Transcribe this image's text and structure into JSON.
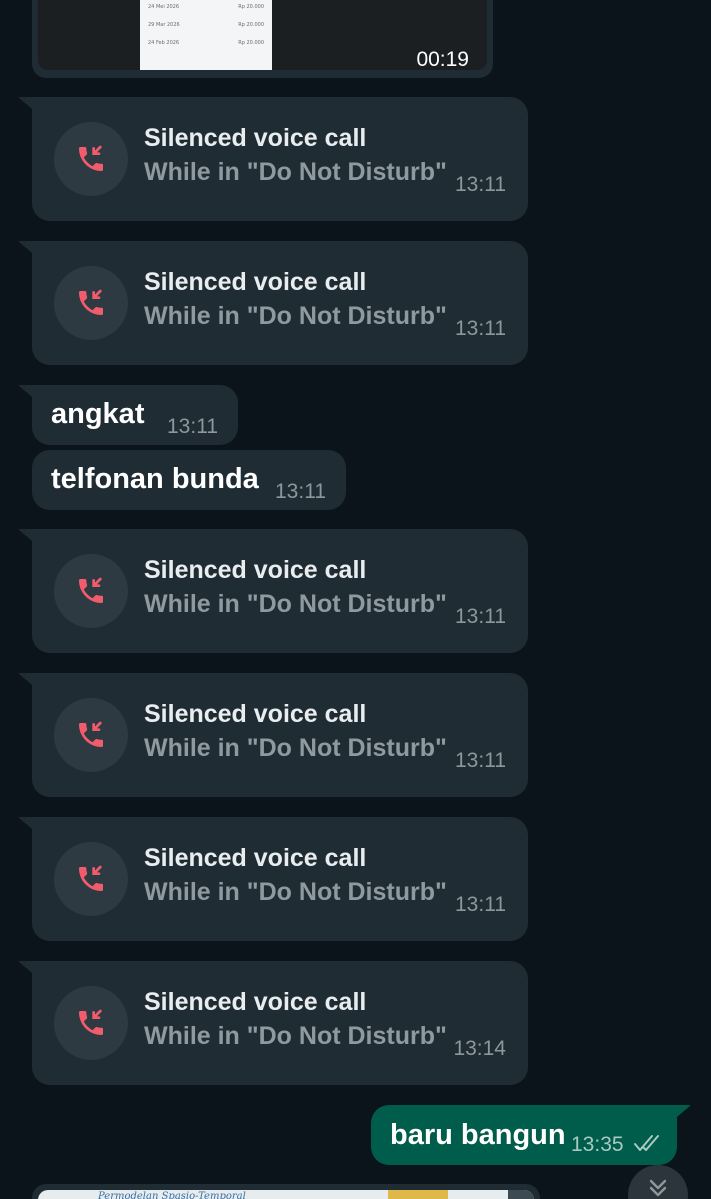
{
  "video_message": {
    "duration": "00:19",
    "receipt_rows": [
      {
        "date": "24 Mei 2026",
        "amount": "Rp 20.000"
      },
      {
        "date": "29 Mar 2026",
        "amount": "Rp 20.000"
      },
      {
        "date": "24 Feb 2026",
        "amount": "Rp 20.000"
      }
    ]
  },
  "messages": [
    {
      "type": "call",
      "title": "Silenced voice call",
      "subtitle": "While in \"Do Not Disturb\"",
      "time": "13:11"
    },
    {
      "type": "call",
      "title": "Silenced voice call",
      "subtitle": "While in \"Do Not Disturb\"",
      "time": "13:11"
    },
    {
      "type": "text",
      "text": "angkat",
      "time": "13:11"
    },
    {
      "type": "text",
      "text": "telfonan bunda",
      "time": "13:11"
    },
    {
      "type": "call",
      "title": "Silenced voice call",
      "subtitle": "While in \"Do Not Disturb\"",
      "time": "13:11"
    },
    {
      "type": "call",
      "title": "Silenced voice call",
      "subtitle": "While in \"Do Not Disturb\"",
      "time": "13:11"
    },
    {
      "type": "call",
      "title": "Silenced voice call",
      "subtitle": "While in \"Do Not Disturb\"",
      "time": "13:11"
    },
    {
      "type": "call",
      "title": "Silenced voice call",
      "subtitle": "While in \"Do Not Disturb\"",
      "time": "13:14"
    }
  ],
  "outgoing": {
    "text": "baru bangun",
    "time": "13:35",
    "status_icon": "double-check-icon"
  },
  "bottom_image": {
    "caption": "Permodelan Spasio-Temporal"
  },
  "icons": {
    "missed_call": "missed-call-icon",
    "scroll": "scroll-down-icon"
  },
  "colors": {
    "background": "#0b141a",
    "incoming_bubble": "#202c33",
    "outgoing_bubble": "#005c4b",
    "missed_call": "#f15c6d"
  }
}
